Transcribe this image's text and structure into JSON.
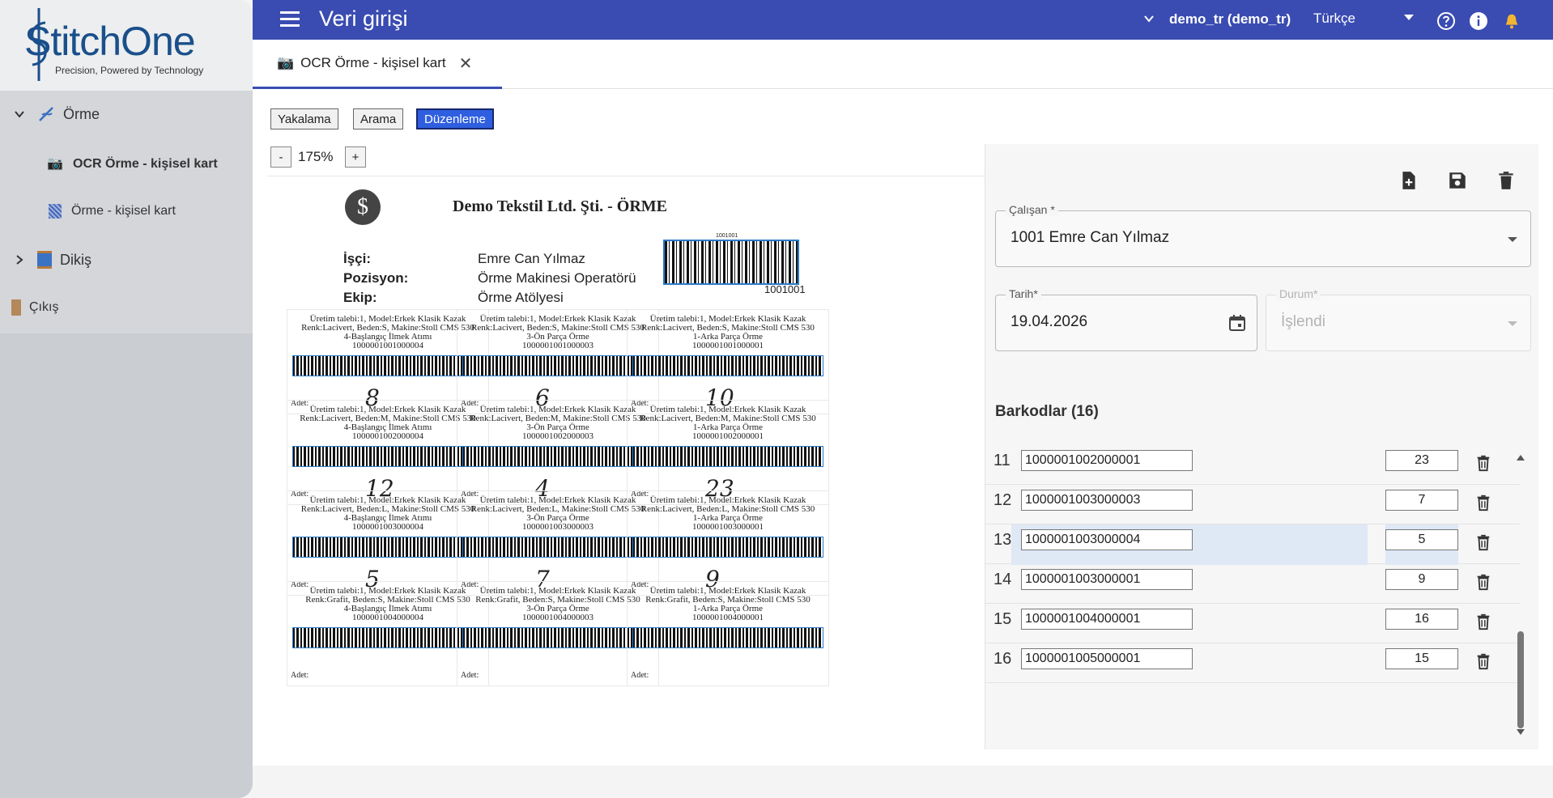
{
  "app": {
    "logo_name": "StitchOne",
    "logo_tagline": "Precision, Powered by Technology"
  },
  "sidebar": {
    "groups": [
      {
        "label": "Örme",
        "expanded": true,
        "items": [
          {
            "label": "OCR Örme - kişisel kart",
            "active": true
          },
          {
            "label": "Örme - kişisel kart",
            "active": false
          }
        ]
      },
      {
        "label": "Dikiş",
        "expanded": false
      }
    ],
    "logout": "Çıkış"
  },
  "topbar": {
    "title": "Veri girişi",
    "user": "demo_tr (demo_tr)",
    "language": "Türkçe"
  },
  "tab": {
    "label": "OCR Örme - kişisel kart"
  },
  "modes": [
    "Yakalama",
    "Arama",
    "Düzenleme"
  ],
  "active_mode": "Düzenleme",
  "zoom": {
    "minus": "-",
    "value": "175%",
    "plus": "+"
  },
  "document": {
    "seal": "$",
    "company": "Demo Tekstil Ltd. Şti. - ÖRME",
    "worker_label": "İşçi:",
    "worker": "Emre Can Yılmaz",
    "position_label": "Pozisyon:",
    "position": "Örme Makinesi Operatörü",
    "team_label": "Ekip:",
    "team": "Örme Atölyesi",
    "employee_code_top": "1001001",
    "employee_code": "1001001",
    "adet_label": "Adet:",
    "cards": [
      {
        "l1": "Üretim talebi:1, Model:Erkek Klasik Kazak",
        "l2": "Renk:Lacivert, Beden:S, Makine:Stoll CMS 530",
        "l3": "4-Başlangıç İlmek Atımı",
        "l4": "1000001001000004",
        "hand": "8"
      },
      {
        "l1": "Üretim talebi:1, Model:Erkek Klasik Kazak",
        "l2": "Renk:Lacivert, Beden:S, Makine:Stoll CMS 530",
        "l3": "3-Ön Parça Örme",
        "l4": "1000001001000003",
        "hand": "6"
      },
      {
        "l1": "Üretim talebi:1, Model:Erkek Klasik Kazak",
        "l2": "Renk:Lacivert, Beden:S, Makine:Stoll CMS 530",
        "l3": "1-Arka Parça Örme",
        "l4": "1000001001000001",
        "hand": "10"
      },
      {
        "l1": "Üretim talebi:1, Model:Erkek Klasik Kazak",
        "l2": "Renk:Lacivert, Beden:M, Makine:Stoll CMS 530",
        "l3": "4-Başlangıç İlmek Atımı",
        "l4": "1000001002000004",
        "hand": "12"
      },
      {
        "l1": "Üretim talebi:1, Model:Erkek Klasik Kazak",
        "l2": "Renk:Lacivert, Beden:M, Makine:Stoll CMS 530",
        "l3": "3-Ön Parça Örme",
        "l4": "1000001002000003",
        "hand": "4"
      },
      {
        "l1": "Üretim talebi:1, Model:Erkek Klasik Kazak",
        "l2": "Renk:Lacivert, Beden:M, Makine:Stoll CMS 530",
        "l3": "1-Arka Parça Örme",
        "l4": "1000001002000001",
        "hand": "23"
      },
      {
        "l1": "Üretim talebi:1, Model:Erkek Klasik Kazak",
        "l2": "Renk:Lacivert, Beden:L, Makine:Stoll CMS 530",
        "l3": "4-Başlangıç İlmek Atımı",
        "l4": "1000001003000004",
        "hand": "5"
      },
      {
        "l1": "Üretim talebi:1, Model:Erkek Klasik Kazak",
        "l2": "Renk:Lacivert, Beden:L, Makine:Stoll CMS 530",
        "l3": "3-Ön Parça Örme",
        "l4": "1000001003000003",
        "hand": "7"
      },
      {
        "l1": "Üretim talebi:1, Model:Erkek Klasik Kazak",
        "l2": "Renk:Lacivert, Beden:L, Makine:Stoll CMS 530",
        "l3": "1-Arka Parça Örme",
        "l4": "1000001003000001",
        "hand": "9"
      },
      {
        "l1": "Üretim talebi:1, Model:Erkek Klasik Kazak",
        "l2": "Renk:Grafit, Beden:S, Makine:Stoll CMS 530",
        "l3": "4-Başlangıç İlmek Atımı",
        "l4": "1000001004000004",
        "hand": ""
      },
      {
        "l1": "Üretim talebi:1, Model:Erkek Klasik Kazak",
        "l2": "Renk:Grafit, Beden:S, Makine:Stoll CMS 530",
        "l3": "3-Ön Parça Örme",
        "l4": "1000001004000003",
        "hand": ""
      },
      {
        "l1": "Üretim talebi:1, Model:Erkek Klasik Kazak",
        "l2": "Renk:Grafit, Beden:S, Makine:Stoll CMS 530",
        "l3": "1-Arka Parça Örme",
        "l4": "1000001004000001",
        "hand": ""
      }
    ]
  },
  "form": {
    "employee_label": "Çalışan *",
    "employee_value": "1001 Emre Can Yılmaz",
    "date_label": "Tarih*",
    "date_value": "19.04.2026",
    "status_label": "Durum*",
    "status_value": "İşlendi",
    "barcodes_title": "Barkodlar (16)",
    "barcodes": [
      {
        "idx": "11",
        "code": "1000001002000001",
        "qty": "23",
        "selected": false
      },
      {
        "idx": "12",
        "code": "1000001003000003",
        "qty": "7",
        "selected": false
      },
      {
        "idx": "13",
        "code": "1000001003000004",
        "qty": "5",
        "selected": true
      },
      {
        "idx": "14",
        "code": "1000001003000001",
        "qty": "9",
        "selected": false
      },
      {
        "idx": "15",
        "code": "1000001004000001",
        "qty": "16",
        "selected": false
      },
      {
        "idx": "16",
        "code": "1000001005000001",
        "qty": "15",
        "selected": false
      }
    ]
  },
  "colors": {
    "topbar": "#3a4cb1",
    "sidebar": "#d4d6da",
    "active_mode": "#2f5fe0",
    "barcode_outline": "#2a7bc9",
    "selected_row": "#dfe8f5"
  },
  "icons": [
    "menu-icon",
    "chevron-down-icon",
    "help-icon",
    "info-icon",
    "bell-icon",
    "camera-icon",
    "close-icon",
    "new-document-icon",
    "save-icon",
    "delete-icon",
    "calendar-icon"
  ]
}
